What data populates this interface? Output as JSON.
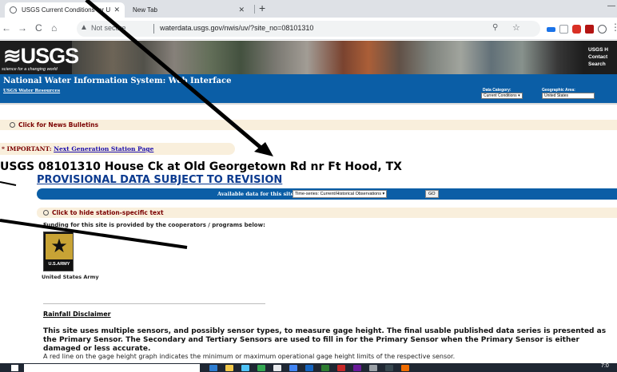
{
  "browser": {
    "tabs": [
      {
        "title": "USGS Current Conditions for U",
        "close": "✕"
      },
      {
        "title": "New Tab",
        "close": "✕"
      }
    ],
    "new_tab_symbol": "+",
    "window_minimize": "—",
    "nav": {
      "back": "←",
      "forward": "→",
      "reload": "C",
      "home": "⌂"
    },
    "omnibox": {
      "security_icon": "warning-triangle-icon",
      "security_text": "Not secure",
      "url": "waterdata.usgs.gov/nwis/uv/?site_no=08101310"
    },
    "extension_icons": [
      "zoom-icon",
      "star-icon",
      "ext-blue-icon",
      "ext-mail-icon",
      "ext-red-badge-icon",
      "ext-pdf-icon",
      "ext-circle-icon",
      "menu-icon"
    ]
  },
  "usgs": {
    "logo_text": "≋USGS",
    "tagline": "science for a changing world",
    "banner_links": [
      "USGS H",
      "Contact",
      "Search"
    ]
  },
  "nwis": {
    "title": "National Water Information System: Web Interface",
    "resources_link": "USGS Water Resources",
    "data_category_label": "Data Category:",
    "data_category_value": "Current Conditions",
    "geographic_area_label": "Geographic Area:",
    "geographic_area_value": "United States"
  },
  "news": {
    "text": "Click for News Bulletins"
  },
  "important": {
    "prefix": "* IMPORTANT: ",
    "link": "Next Generation Station Page"
  },
  "station": {
    "title": "USGS 08101310 House Ck at Old Georgetown Rd nr Ft Hood, TX",
    "provisional": "PROVISIONAL DATA SUBJECT TO REVISION"
  },
  "available": {
    "label": "Available data for this site",
    "select_value": "Time-series:  Current/Historical Observations",
    "go": "GO"
  },
  "hide_station": {
    "text": "Click to hide station-specific text"
  },
  "funding": {
    "text": "Funding for this site is provided by the cooperators / programs below:",
    "logo_word": "U.S.ARMY",
    "caption": "United States Army"
  },
  "disclaimer": {
    "heading": "Rainfall Disclaimer",
    "para1": "This site uses multiple sensors, and possibly sensor types, to measure gage height. The final usable published data series is presented as the Primary Sensor. The Secondary and Tertiary Sensors are used to fill in for the Primary Sensor when the Primary Sensor is either damaged or less accurate.",
    "para2": "A red line on the gage height graph indicates the minimum or maximum operational gage height limits of the respective sensor."
  },
  "taskbar": {
    "clock": "7:0"
  },
  "colors": {
    "usgs_blue": "#0b5ea6",
    "bulletin_bg": "#f9efdc",
    "bulletin_text": "#7a0000",
    "provisional_blue": "#0b3a8f",
    "annotation_arrow": "#000000"
  }
}
